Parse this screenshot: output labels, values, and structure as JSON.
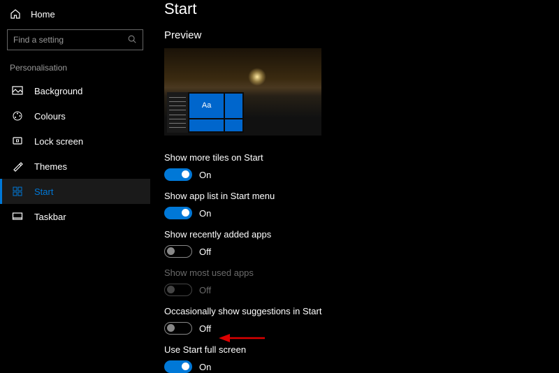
{
  "home_label": "Home",
  "search_placeholder": "Find a setting",
  "section": "Personalisation",
  "nav": [
    {
      "label": "Background"
    },
    {
      "label": "Colours"
    },
    {
      "label": "Lock screen"
    },
    {
      "label": "Themes"
    },
    {
      "label": "Start"
    },
    {
      "label": "Taskbar"
    }
  ],
  "page_title": "Start",
  "preview_heading": "Preview",
  "preview_tile_text": "Aa",
  "settings": [
    {
      "label": "Show more tiles on Start",
      "state": "On",
      "on": true,
      "disabled": false
    },
    {
      "label": "Show app list in Start menu",
      "state": "On",
      "on": true,
      "disabled": false
    },
    {
      "label": "Show recently added apps",
      "state": "Off",
      "on": false,
      "disabled": false
    },
    {
      "label": "Show most used apps",
      "state": "Off",
      "on": false,
      "disabled": true
    },
    {
      "label": "Occasionally show suggestions in Start",
      "state": "Off",
      "on": false,
      "disabled": false
    },
    {
      "label": "Use Start full screen",
      "state": "On",
      "on": true,
      "disabled": false
    }
  ]
}
